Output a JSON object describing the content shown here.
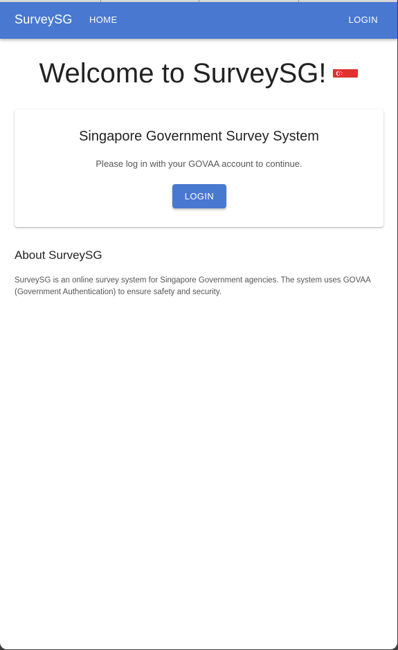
{
  "navbar": {
    "brand": "SurveySG",
    "home": "HOME",
    "login": "LOGIN",
    "color": "#4878d0"
  },
  "hero": {
    "welcome": "Welcome to SurveySG!",
    "flag_icon": "singapore-flag-icon"
  },
  "card": {
    "title": "Singapore Government Survey System",
    "text": "Please log in with your GOVAA account to continue.",
    "button": "LOGIN"
  },
  "about": {
    "title": "About SurveySG",
    "text": "SurveySG is an online survey system for Singapore Government agencies. The system uses GOVAA (Government Authentication) to ensure safety and security."
  }
}
